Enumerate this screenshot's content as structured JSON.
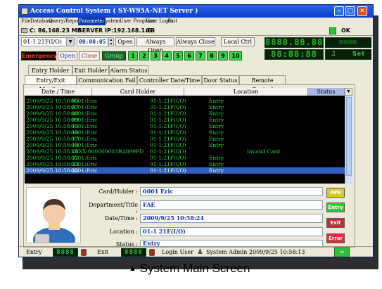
{
  "window": {
    "title": "Access Control System ( SY-W95A-NET Server )"
  },
  "menu": [
    {
      "label": "File",
      "active": false
    },
    {
      "label": "Database",
      "active": false
    },
    {
      "label": "Query/Report",
      "active": false
    },
    {
      "label": "Parameter",
      "active": true
    },
    {
      "label": "System",
      "active": false
    },
    {
      "label": "User Program",
      "active": false
    },
    {
      "label": "User Login",
      "active": false
    },
    {
      "label": "Exit",
      "active": false
    }
  ],
  "info": {
    "disk": "C: 86,168.23 MB",
    "server": "SERVER IP:192.168.1.63",
    "server_no": "01",
    "ok": "OK"
  },
  "toolbar": {
    "controller": "01-1 21F(I/O)",
    "time": "00:00:05",
    "open": "Open",
    "always_open": "Always Open",
    "always_close": "Always Close",
    "local_ctrl": "Local Ctrl",
    "emergency": "Emergency",
    "open2": "Open",
    "close": "Close",
    "group": "Group",
    "doors": [
      "1",
      "2",
      "3",
      "4",
      "5",
      "6",
      "7",
      "8",
      "9",
      "10"
    ],
    "lcd_top": "8888.88.88",
    "lcd_bottom": "88:88:88",
    "set": "Set"
  },
  "tabs_row1": [
    "Entry Holder",
    "Exit Holder",
    "Alarm Status"
  ],
  "tabs_row2": [
    "Entry/Exit Monitor",
    "Communication Fail",
    "Controller Date/Time",
    "Door Status",
    "Remote Control"
  ],
  "table": {
    "columns": [
      "Date / Time",
      "Card Holder",
      "Location",
      "Status"
    ],
    "rows": [
      {
        "dt": "2009/9/25  10:58:05",
        "holder": "0001:Eric",
        "location": "01-1:21F(I/O)",
        "status": "Entry",
        "extra": "",
        "selected": false
      },
      {
        "dt": "2009/9/25  10:58:07",
        "holder": "0001:Eric",
        "location": "01-1:21F(I/O)",
        "status": "Entry",
        "extra": "",
        "selected": false
      },
      {
        "dt": "2009/9/25  10:58:08",
        "holder": "0001:Eric",
        "location": "01-1:21F(I/O)",
        "status": "Entry",
        "extra": "",
        "selected": false
      },
      {
        "dt": "2009/9/25  10:58:09",
        "holder": "0001:Eric",
        "location": "01-1:21F(I/O)",
        "status": "Entry",
        "extra": "",
        "selected": false
      },
      {
        "dt": "2009/9/25  10:58:15",
        "holder": "0001:Eric",
        "location": "01-1:21F(I/O)",
        "status": "Entry",
        "extra": "",
        "selected": false
      },
      {
        "dt": "2009/9/25  10:58:16",
        "holder": "0001:Eric",
        "location": "01-1:21F(I/O)",
        "status": "Entry",
        "extra": "",
        "selected": false
      },
      {
        "dt": "2009/9/25  10:58:17",
        "holder": "0001:Eric",
        "location": "01-1:21F(I/O)",
        "status": "Entry",
        "extra": "",
        "selected": false
      },
      {
        "dt": "2009/9/25  10:58:18",
        "holder": "0001:Eric",
        "location": "01-1:21F(I/O)",
        "status": "Entry",
        "extra": "",
        "selected": false
      },
      {
        "dt": "2009/9/25  10:58:20",
        "holder": "XXXX:000000003BA899FD",
        "location": "01-1:21F(I/O)",
        "status": "",
        "extra": "Invalid Card",
        "selected": false
      },
      {
        "dt": "2009/9/25  10:58:22",
        "holder": "0001:Eric",
        "location": "01-1:21F(I/O)",
        "status": "Entry",
        "extra": "",
        "selected": false
      },
      {
        "dt": "2009/9/25  10:58:23",
        "holder": "0001:Eric",
        "location": "01-1:21F(I/O)",
        "status": "Entry",
        "extra": "",
        "selected": false
      },
      {
        "dt": "2009/9/25  10:58:24",
        "holder": "0001:Eric",
        "location": "01-1:21F(I/O)",
        "status": "Entry",
        "extra": "",
        "selected": true
      }
    ]
  },
  "details": {
    "card_holder_label": "Card/Holder :",
    "card_holder": "0001 Eric",
    "dept_label": "Department/Title :",
    "dept": "FAE",
    "datetime_label": "Date/Time :",
    "datetime": "2009/9/25 10:58:24",
    "location_label": "Location :",
    "location": "01-1 21F(I/O)",
    "status_label": "Status :",
    "status": "Entry"
  },
  "side_buttons": [
    {
      "label": "APB",
      "color": "#d9c34a"
    },
    {
      "label": "Entry",
      "color": "#37c43f"
    },
    {
      "label": "Exit",
      "color": "#c22f3a"
    },
    {
      "label": "Error",
      "color": "#d8323c"
    }
  ],
  "statusbar": {
    "entry_label": "Entry",
    "entry_count": "8888",
    "exit_label": "Exit",
    "exit_count": "8888",
    "login_label": "Login User",
    "login_info": "System Admin 2009/9/25 10:58:13"
  },
  "caption": "System Main Screen"
}
